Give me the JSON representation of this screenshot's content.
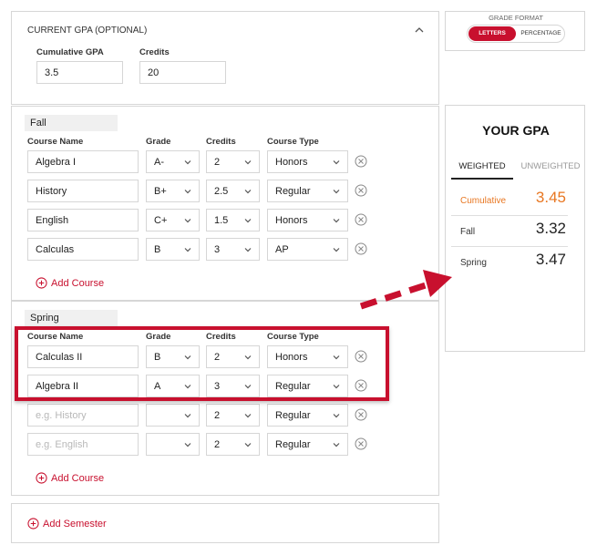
{
  "current_gpa": {
    "title": "CURRENT GPA (OPTIONAL)",
    "cumulative_label": "Cumulative GPA",
    "cumulative_value": "3.5",
    "credits_label": "Credits",
    "credits_value": "20"
  },
  "columns": {
    "course_name": "Course Name",
    "grade": "Grade",
    "credits": "Credits",
    "course_type": "Course Type"
  },
  "fall": {
    "title": "Fall",
    "courses": [
      {
        "name": "Algebra I",
        "grade": "A-",
        "credits": "2",
        "type": "Honors"
      },
      {
        "name": "History",
        "grade": "B+",
        "credits": "2.5",
        "type": "Regular"
      },
      {
        "name": "English",
        "grade": "C+",
        "credits": "1.5",
        "type": "Honors"
      },
      {
        "name": "Calculas",
        "grade": "B",
        "credits": "3",
        "type": "AP"
      }
    ],
    "add_label": "Add Course"
  },
  "spring": {
    "title": "Spring",
    "courses": [
      {
        "name": "Calculas II",
        "grade": "B",
        "credits": "2",
        "type": "Honors"
      },
      {
        "name": "Algebra II",
        "grade": "A",
        "credits": "3",
        "type": "Regular"
      },
      {
        "name_placeholder": "e.g. History",
        "grade": "",
        "credits": "2",
        "type": "Regular"
      },
      {
        "name_placeholder": "e.g. English",
        "grade": "",
        "credits": "2",
        "type": "Regular"
      }
    ],
    "add_label": "Add Course"
  },
  "add_semester_label": "Add Semester",
  "grade_format": {
    "title": "GRADE FORMAT",
    "options": [
      "LETTERS",
      "PERCENTAGE"
    ],
    "selected": "LETTERS"
  },
  "result": {
    "title": "YOUR GPA",
    "tabs": [
      "WEIGHTED",
      "UNWEIGHTED"
    ],
    "active_tab": "WEIGHTED",
    "rows": [
      {
        "name": "Cumulative",
        "value": "3.45"
      },
      {
        "name": "Fall",
        "value": "3.32"
      },
      {
        "name": "Spring",
        "value": "3.47"
      }
    ]
  },
  "colors": {
    "accent": "#c8102e",
    "orange": "#e87722",
    "highlight_border": "#c8102e"
  },
  "icons": [
    "chevron-up-icon",
    "chevron-down-icon",
    "remove-circle-icon",
    "add-circle-icon",
    "arrow-icon"
  ]
}
